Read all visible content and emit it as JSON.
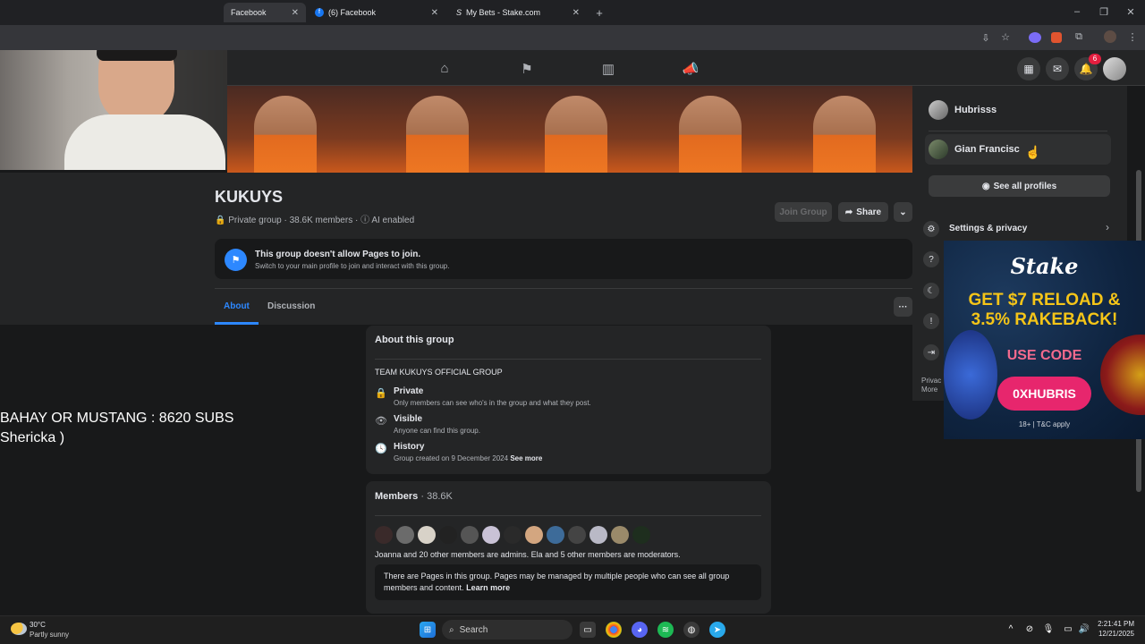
{
  "browser": {
    "tabs": [
      {
        "label": "Facebook",
        "active": true
      },
      {
        "label": "(6) Facebook",
        "active": false
      },
      {
        "label": "My Bets - Stake.com",
        "active": false
      }
    ],
    "new_tab": "+"
  },
  "fb": {
    "notification_count": "6",
    "group": {
      "name": "KUKUYS",
      "privacy": "Private group",
      "members": "38.6K members",
      "ai": "AI enabled",
      "join_label": "Join Group",
      "share_label": "Share"
    },
    "notice": {
      "title": "This group doesn't allow Pages to join.",
      "subtitle": "Switch to your main profile to join and interact with this group."
    },
    "tabs": [
      "About",
      "Discussion"
    ],
    "about": {
      "heading": "About this group",
      "description": "TEAM KUKUYS OFFICIAL GROUP",
      "private_title": "Private",
      "private_desc": "Only members can see who's in the group and what they post.",
      "visible_title": "Visible",
      "visible_desc": "Anyone can find this group.",
      "history_title": "History",
      "history_desc": "Group created on 9 December 2024",
      "see_more": "See more"
    },
    "members": {
      "heading": "Members",
      "count": "38.6K",
      "admins_text": "Joanna and 20 other members are admins. Ela and 5 other members are moderators.",
      "pages_text": "There are Pages in this group. Pages may be managed by multiple people who can see all group members and content.",
      "learn_more": "Learn more"
    },
    "menu": {
      "profile1": "Hubrisss",
      "profile2": "Gian Francisc",
      "see_all": "See all profiles",
      "settings": "Settings & privacy",
      "privacy": "Privac",
      "more": "More"
    }
  },
  "ad": {
    "brand": "Stake",
    "headline1": "GET $7 RELOAD &",
    "headline2": "3.5% RAKEBACK!",
    "use_code": "USE CODE",
    "code": "0XHUBRIS",
    "disclaimer": "18+ | T&C apply"
  },
  "overlay": {
    "line1": "BAHAY OR MUSTANG : 8620 SUBS",
    "line2": "Shericka )"
  },
  "taskbar": {
    "temp": "30°C",
    "weather": "Partly sunny",
    "search": "Search",
    "time": "2:21:41 PM",
    "date": "12/21/2025"
  },
  "colors": {
    "accent": "#2d88ff",
    "ad_button": "#e7266d",
    "ad_text": "#f5c518"
  }
}
